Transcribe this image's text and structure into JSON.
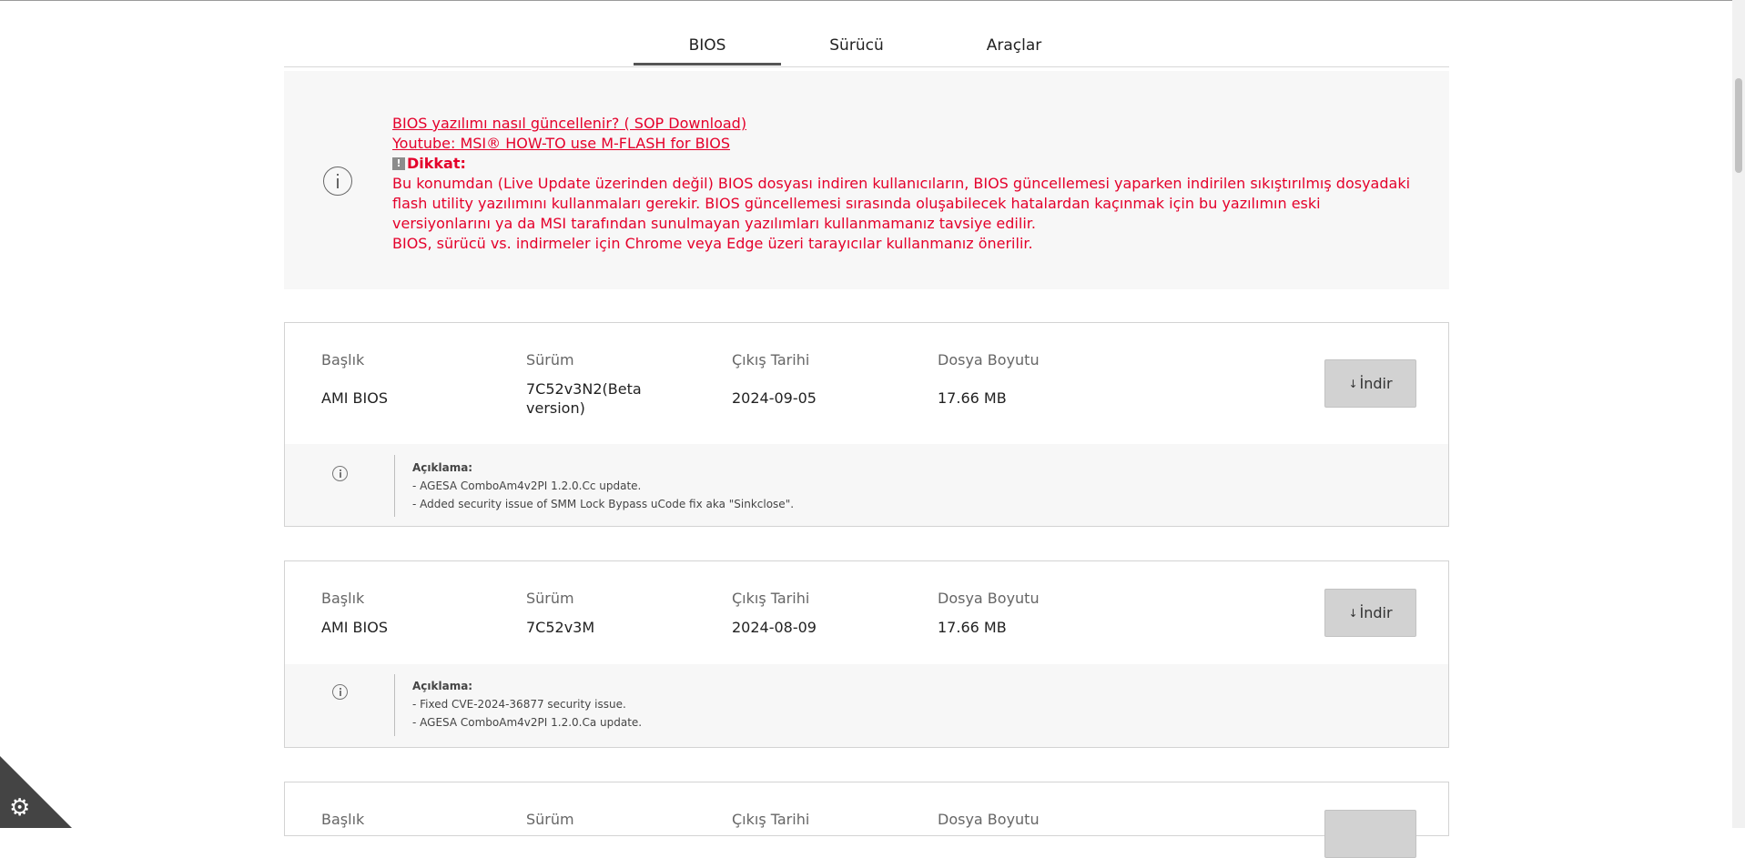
{
  "tabs": [
    {
      "label": "BIOS",
      "active": true
    },
    {
      "label": "Sürücü",
      "active": false
    },
    {
      "label": "Araçlar",
      "active": false
    }
  ],
  "notice": {
    "link1_text": "BIOS yazılımı nasıl güncellenir?",
    "link1_sub": " ( SOP Download)",
    "link2": "Youtube: MSI® HOW-TO use M-FLASH for BIOS",
    "warning_title": "Dikkat:",
    "paragraph1": "Bu konumdan (Live Update üzerinden değil) BIOS dosyası indiren kullanıcıların, BIOS güncellemesi yaparken indirilen sıkıştırılmış dosyadaki flash utility yazılımını kullanmaları gerekir. BIOS güncellemesi sırasında oluşabilecek hatalardan kaçınmak için bu yazılımın eski versiyonlarını ya da MSI tarafından sunulmayan yazılımları kullanmamanız tavsiye edilir.",
    "paragraph2": "BIOS, sürücü vs. indirmeler için Chrome veya Edge üzeri tarayıcılar kullanmanız önerilir."
  },
  "columns": {
    "title": "Başlık",
    "version": "Sürüm",
    "release_date": "Çıkış Tarihi",
    "file_size": "Dosya Boyutu"
  },
  "download_label": "İndir",
  "description_label": "Açıklama:",
  "releases": [
    {
      "title": "AMI BIOS",
      "version_line1": "7C52v3N2(Beta",
      "version_line2": "version)",
      "date": "2024-09-05",
      "size": "17.66 MB",
      "notes": [
        "- AGESA ComboAm4v2PI 1.2.0.Cc update.",
        "- Added security issue of SMM Lock Bypass uCode fix aka \"Sinkclose\"."
      ]
    },
    {
      "title": "AMI BIOS",
      "version_line1": "7C52v3M",
      "date": "2024-08-09",
      "size": "17.66 MB",
      "notes": [
        "- Fixed CVE-2024-36877 security issue.",
        "- AGESA ComboAm4v2PI 1.2.0.Ca update."
      ]
    }
  ],
  "icons": {
    "info": "info-circle-icon",
    "download": "down-arrow-icon",
    "cookie": "gear-icon"
  }
}
